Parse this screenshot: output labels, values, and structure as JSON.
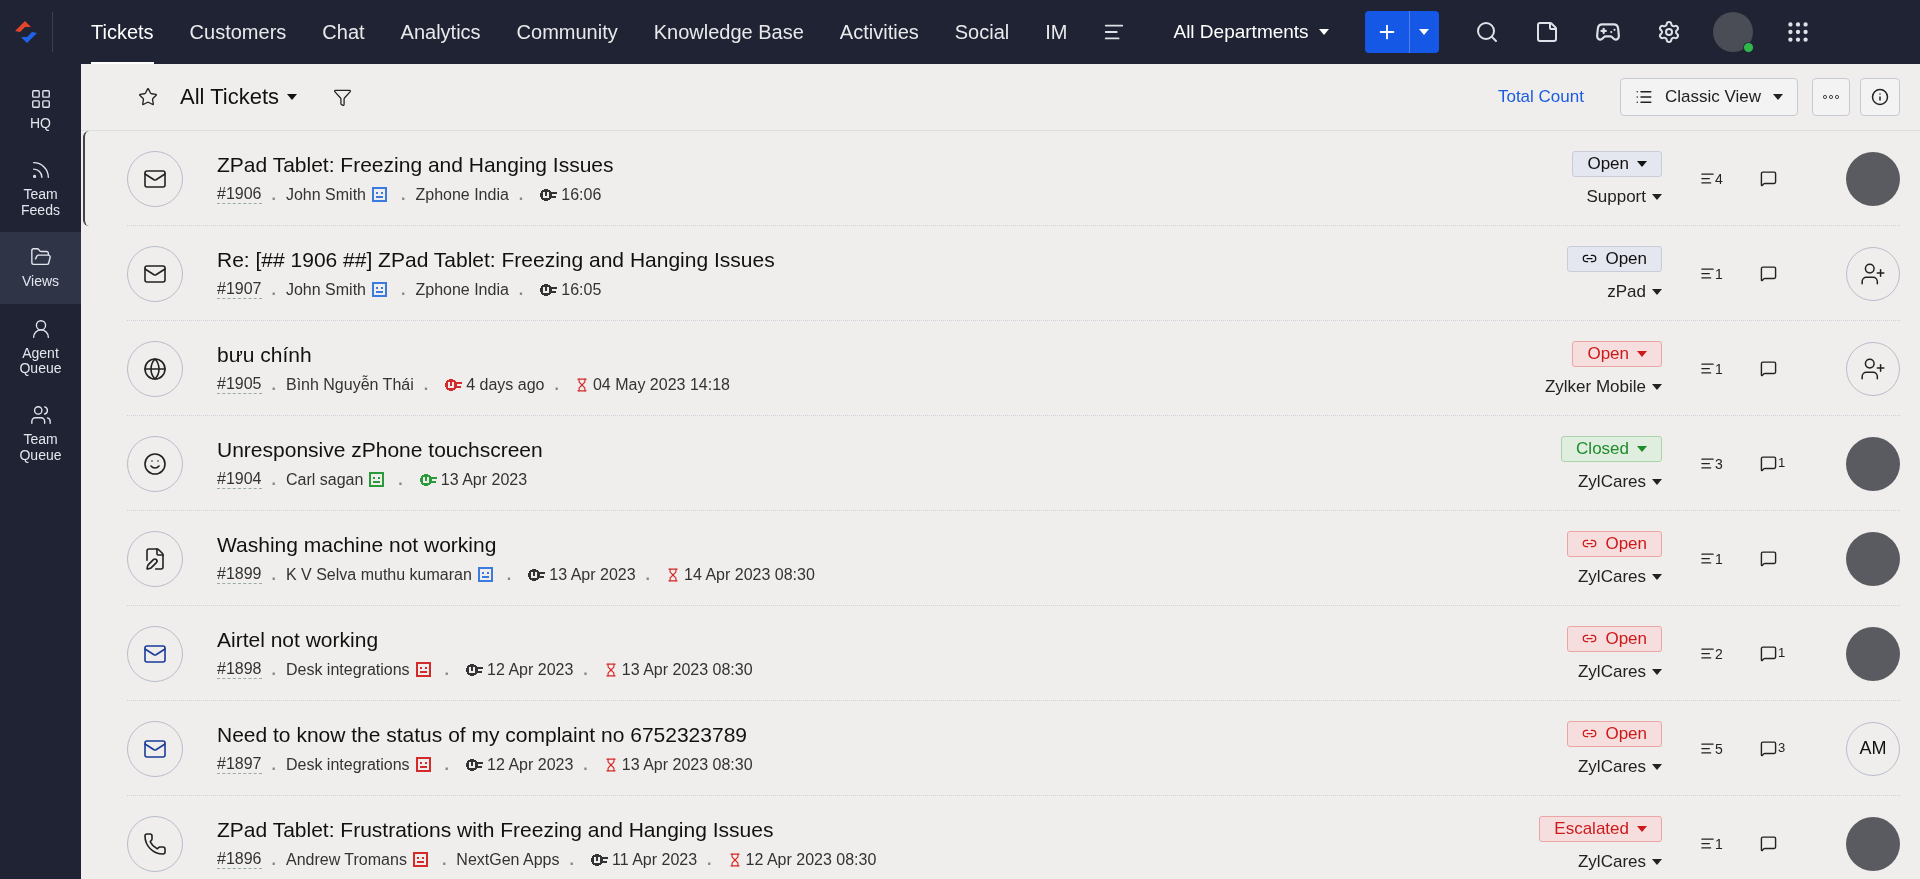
{
  "top_nav": {
    "tabs": [
      {
        "label": "Tickets",
        "selected": true
      },
      {
        "label": "Customers",
        "selected": false
      },
      {
        "label": "Chat",
        "selected": false
      },
      {
        "label": "Analytics",
        "selected": false
      },
      {
        "label": "Community",
        "selected": false
      },
      {
        "label": "Knowledge Base",
        "selected": false
      },
      {
        "label": "Activities",
        "selected": false
      },
      {
        "label": "Social",
        "selected": false
      },
      {
        "label": "IM",
        "selected": false
      }
    ],
    "department": "All Departments"
  },
  "sidebar": {
    "items": [
      {
        "label": "HQ",
        "kind": "grid",
        "selected": false
      },
      {
        "label": "Team Feeds",
        "kind": "feed",
        "selected": false
      },
      {
        "label": "Views",
        "kind": "views",
        "selected": true
      },
      {
        "label": "Agent Queue",
        "kind": "agent",
        "selected": false
      },
      {
        "label": "Team Queue",
        "kind": "team",
        "selected": false
      }
    ]
  },
  "toolbar": {
    "view_title": "All Tickets",
    "total_count": "Total Count",
    "view_mode": "Classic View"
  },
  "tickets": [
    {
      "selected": true,
      "kind": "email-in",
      "title": "ZPad Tablet: Freezing and Hanging Issues",
      "meta": [
        {
          "kind": "id",
          "text": "#1906"
        },
        {
          "kind": "contact",
          "sep": ".",
          "text": "John Smith",
          "color": "#3b7be0"
        },
        {
          "kind": "account",
          "sep": ".",
          "text": "Zphone India"
        },
        {
          "kind": "created",
          "sep": ".",
          "text": "16:06",
          "color": "#333333"
        }
      ],
      "status": {
        "kind": "normal",
        "label": "Open",
        "linked": false
      },
      "department": "Support",
      "threads": "4",
      "assignee": {
        "kind": "photo"
      }
    },
    {
      "selected": false,
      "kind": "email-in",
      "title": "Re: [## 1906 ##] ZPad Tablet: Freezing and Hanging Issues",
      "meta": [
        {
          "kind": "id",
          "text": "#1907"
        },
        {
          "kind": "contact",
          "sep": ".",
          "text": "John Smith",
          "color": "#3b7be0"
        },
        {
          "kind": "account",
          "sep": ".",
          "text": "Zphone India"
        },
        {
          "kind": "created",
          "sep": ".",
          "text": "16:05",
          "color": "#333333"
        }
      ],
      "status": {
        "kind": "normal",
        "label": "Open",
        "linked": true
      },
      "department": "zPad",
      "threads": "1",
      "assignee": {
        "kind": "unassigned"
      }
    },
    {
      "selected": false,
      "kind": "web",
      "title": "bưu chính",
      "meta": [
        {
          "kind": "id",
          "text": "#1905"
        },
        {
          "kind": "contact",
          "sep": ".",
          "text": "Bình Nguyễn Thái"
        },
        {
          "kind": "created",
          "sep": ".",
          "text": "4 days ago",
          "color": "#d42a2a"
        },
        {
          "kind": "due",
          "sep": ".",
          "text": "04 May 2023 14:18"
        }
      ],
      "status": {
        "kind": "overdue",
        "label": "Open",
        "linked": false
      },
      "department": "Zylker Mobile",
      "threads": "1",
      "assignee": {
        "kind": "unassigned"
      }
    },
    {
      "selected": false,
      "kind": "feedback",
      "title": "Unresponsive zPhone touchscreen",
      "meta": [
        {
          "kind": "id",
          "text": "#1904"
        },
        {
          "kind": "contact",
          "sep": ".",
          "text": "Carl sagan",
          "color": "#2a9a3a"
        },
        {
          "kind": "created",
          "sep": ".",
          "text": "13 Apr 2023",
          "color": "#2a9a3a"
        }
      ],
      "status": {
        "kind": "closed",
        "label": "Closed",
        "linked": false
      },
      "department": "ZylCares",
      "threads": "3",
      "comments": "1",
      "assignee": {
        "kind": "photo"
      }
    },
    {
      "selected": false,
      "kind": "form",
      "title": "Washing machine not working",
      "meta": [
        {
          "kind": "id",
          "text": "#1899"
        },
        {
          "kind": "contact",
          "sep": ".",
          "text": "K V Selva muthu kumaran",
          "color": "#3b7be0"
        },
        {
          "kind": "created",
          "sep": ".",
          "text": "13 Apr 2023",
          "color": "#333333"
        },
        {
          "kind": "due",
          "sep": ".",
          "text": "14 Apr 2023 08:30"
        }
      ],
      "status": {
        "kind": "overdue",
        "label": "Open",
        "linked": true
      },
      "department": "ZylCares",
      "threads": "1",
      "assignee": {
        "kind": "photo"
      }
    },
    {
      "selected": false,
      "kind": "email-out",
      "title": "Airtel not working",
      "meta": [
        {
          "kind": "id",
          "text": "#1898"
        },
        {
          "kind": "contact",
          "sep": ".",
          "text": "Desk integrations",
          "color": "#d42a2a"
        },
        {
          "kind": "created",
          "sep": ".",
          "text": "12 Apr 2023",
          "color": "#333333"
        },
        {
          "kind": "due",
          "sep": ".",
          "text": "13 Apr 2023 08:30"
        }
      ],
      "status": {
        "kind": "overdue",
        "label": "Open",
        "linked": true
      },
      "department": "ZylCares",
      "threads": "2",
      "comments": "1",
      "assignee": {
        "kind": "photo"
      }
    },
    {
      "selected": false,
      "kind": "email-out",
      "title": "Need to know the status of my complaint no 6752323789",
      "meta": [
        {
          "kind": "id",
          "text": "#1897"
        },
        {
          "kind": "contact",
          "sep": ".",
          "text": "Desk integrations",
          "color": "#d42a2a"
        },
        {
          "kind": "created",
          "sep": ".",
          "text": "12 Apr 2023",
          "color": "#333333"
        },
        {
          "kind": "due",
          "sep": ".",
          "text": "13 Apr 2023 08:30"
        }
      ],
      "status": {
        "kind": "overdue",
        "label": "Open",
        "linked": true
      },
      "department": "ZylCares",
      "threads": "5",
      "comments": "3",
      "assignee": {
        "kind": "initials",
        "text": "AM"
      }
    },
    {
      "selected": false,
      "kind": "phone",
      "title": "ZPad Tablet: Frustrations with Freezing and Hanging Issues",
      "meta": [
        {
          "kind": "id",
          "text": "#1896"
        },
        {
          "kind": "contact",
          "sep": ".",
          "text": "Andrew Tromans",
          "color": "#d42a2a"
        },
        {
          "kind": "account",
          "sep": ".",
          "text": "NextGen Apps"
        },
        {
          "kind": "created",
          "sep": ".",
          "text": "11 Apr 2023",
          "color": "#333333"
        },
        {
          "kind": "due",
          "sep": ".",
          "text": "12 Apr 2023 08:30"
        }
      ],
      "status": {
        "kind": "overdue",
        "label": "Escalated",
        "linked": false
      },
      "department": "ZylCares",
      "threads": "1",
      "assignee": {
        "kind": "photo"
      }
    }
  ]
}
